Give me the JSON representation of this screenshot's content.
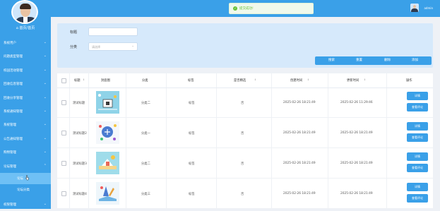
{
  "sidebar": {
    "home_label": "首页/首页",
    "items": [
      {
        "label": "系统用户"
      },
      {
        "label": "问题类型管理"
      },
      {
        "label": "校园活动管理"
      },
      {
        "label": "回收信息管理"
      },
      {
        "label": "回收分享管理"
      },
      {
        "label": "系统通知管理"
      },
      {
        "label": "系统管理"
      },
      {
        "label": "公告通知管理"
      },
      {
        "label": "购物管理"
      },
      {
        "label": "论坛管理"
      }
    ],
    "subitems": [
      {
        "label": "论坛"
      },
      {
        "label": "论坛分类"
      }
    ],
    "last_item": {
      "label": "权限管理"
    }
  },
  "topbar": {
    "toast_text": "提交成功!",
    "user_name": "admin"
  },
  "search": {
    "title_label": "标题",
    "category_label": "分类",
    "category_placeholder": "请选择",
    "buttons": {
      "search": "搜索",
      "reset": "重置",
      "delete": "删除",
      "add": "添加"
    }
  },
  "table": {
    "columns": [
      "标题",
      "封面图",
      "分类",
      "标签",
      "是否精选",
      "创建时间",
      "更新时间",
      "操作"
    ],
    "rows": [
      {
        "title": "测试标题",
        "category": "分类二",
        "tag": "标签",
        "featured": "否",
        "created": "2025-02-26 18:21:49",
        "updated": "2025-02-26 11:29:46",
        "act1": "详情",
        "act2": "查看评论"
      },
      {
        "title": "测试标题2",
        "category": "分类一",
        "tag": "标签",
        "featured": "否",
        "created": "2025-02-26 18:21:49",
        "updated": "2025-02-26 18:21:49",
        "act1": "详情",
        "act2": "查看评论"
      },
      {
        "title": "测试标题3",
        "category": "分类二",
        "tag": "标签",
        "featured": "否",
        "created": "2025-02-26 18:21:49",
        "updated": "2025-02-26 18:21:49",
        "act1": "详情",
        "act2": "查看评论"
      },
      {
        "title": "测试标题4",
        "category": "分类三",
        "tag": "标签",
        "featured": "否",
        "created": "2025-02-26 18:21:49",
        "updated": "2025-02-26 18:21:49",
        "act1": "详情",
        "act2": "查看评论"
      }
    ]
  },
  "colors": {
    "primary": "#3aa0e8",
    "success": "#67c23a"
  }
}
